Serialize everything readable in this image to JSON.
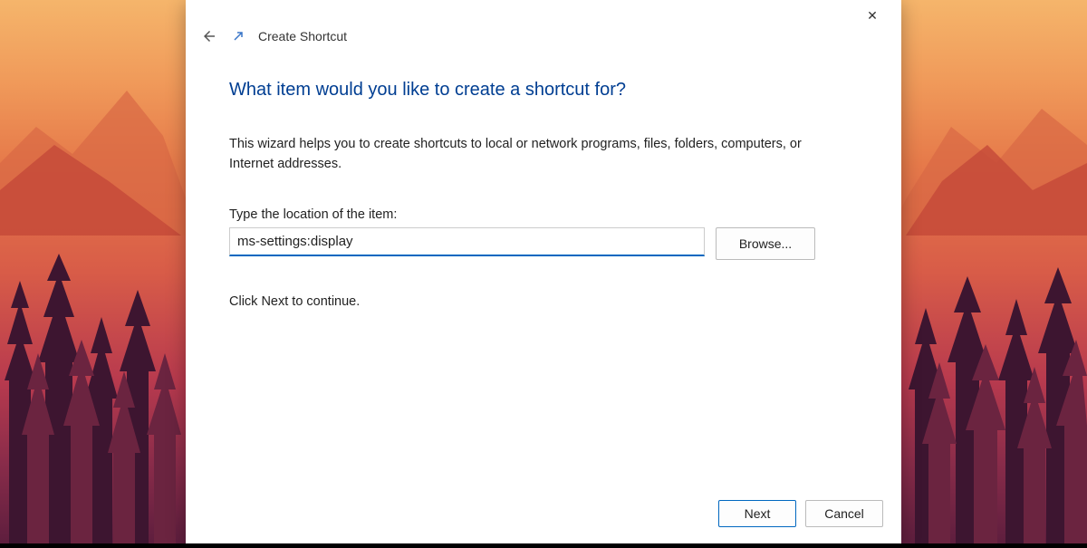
{
  "dialog": {
    "title": "Create Shortcut",
    "close_icon": "✕",
    "heading": "What item would you like to create a shortcut for?",
    "description": "This wizard helps you to create shortcuts to local or network programs, files, folders, computers, or Internet addresses.",
    "field_label": "Type the location of the item:",
    "location_value": "ms-settings:display",
    "browse_label": "Browse...",
    "continue_text": "Click Next to continue.",
    "next_label": "Next",
    "cancel_label": "Cancel"
  }
}
